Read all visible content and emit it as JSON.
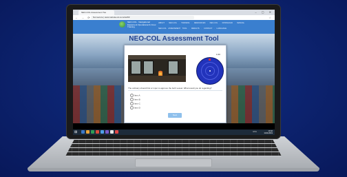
{
  "browser": {
    "tab_title": "NEO-COL Assessment Too",
    "window_controls": "– ▢ ✕",
    "nav_icons": "← → ⟳",
    "url": "Not secure | www.nebula-col.com/stuff/#"
  },
  "site": {
    "brand_lines": [
      "NEO-COL · Navigational",
      "Equipment Operational & Crew",
      "Training"
    ],
    "nav_row1": "ABOUT · NEO-COL · TRAINING · RESOURCES · NEO-COL · DOWNLOAD · MANUAL",
    "nav_row2": "NEO-COL ASSESSMENT TOOL · RESULTS · CONTACT · LANGUAGE",
    "page_title": "NEO-COL Assessment Tool"
  },
  "assessment": {
    "timer": "1:00",
    "question": "The ordinary should first or input to approve the both vessel. What would you do regarding?",
    "options": [
      "Item A",
      "Item B",
      "Item C",
      "Item D"
    ],
    "next_label": "Next"
  },
  "taskbar": {
    "start_icon": "windows-icon",
    "tray_text": "ENG",
    "clock_time": "10:42",
    "clock_date": "11/11/2019"
  },
  "colors": {
    "background": "#0b1f63",
    "header": "#3a7fcf",
    "title": "#1e3f8f",
    "radar": "#2233bb",
    "button": "#8fc0ec"
  }
}
